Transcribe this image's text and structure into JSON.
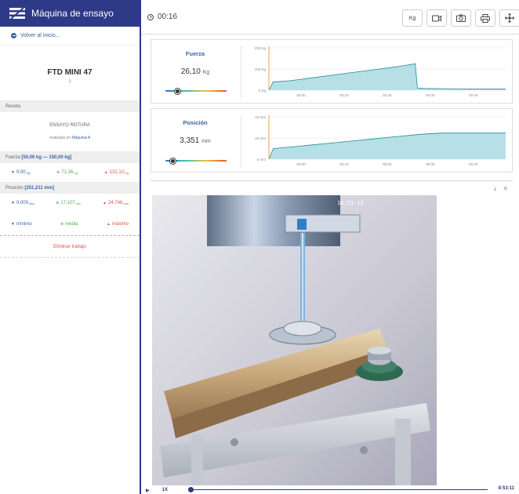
{
  "app": {
    "title": "Máquina de ensayo",
    "back_label": "Volver al inicio..."
  },
  "machine": {
    "name": "FTD MINI 47",
    "number": "1"
  },
  "recipe": {
    "header": "Receta",
    "name": "ENSAYO ROTURA",
    "performed_in_prefix": "realizado en",
    "performed_in_machine": "Máquina A"
  },
  "force_stats": {
    "header_prefix": "Fuerza",
    "range": "[50,00 kg — 150,00 kg]",
    "min": "0,00",
    "avg": "71,36",
    "max": "132,10",
    "unit": "Kg"
  },
  "position_stats": {
    "header_prefix": "Posición",
    "range": "[251,211 mm]",
    "min": "0,009",
    "avg": "17,107",
    "max": "24,748",
    "unit": "mm"
  },
  "legend": {
    "min": "mínimo",
    "avg": "media",
    "max": "máximo"
  },
  "delete_label": "Eliminar trabajo",
  "topbar": {
    "time": "00:16",
    "unit_button": "Kg"
  },
  "colors": {
    "brand": "#2e3a87",
    "accent": "#3a5fa8",
    "chart_line": "#1f8a9c",
    "chart_fill": "#a9dbe0",
    "marker": "#f0a030"
  },
  "chart_data": [
    {
      "type": "area",
      "title": "Fuerza",
      "current_value": "26,10",
      "current_unit": "Kg",
      "gauge_level": 0.2,
      "y_ticks": [
        "200 Kg",
        "100 Kg",
        "0 Kg"
      ],
      "ylim": [
        0,
        200
      ],
      "x_ticks": [
        "00:00",
        "00:10",
        "00:20",
        "00:30",
        "00:40",
        "00:50"
      ],
      "x": [
        0,
        1,
        2,
        5,
        10,
        15,
        20,
        25,
        30,
        34,
        34.5,
        36,
        40,
        45,
        50,
        55
      ],
      "values": [
        0,
        40,
        40,
        45,
        58,
        72,
        85,
        98,
        112,
        125,
        10,
        8,
        7,
        6,
        6,
        6
      ]
    },
    {
      "type": "area",
      "title": "Posición",
      "current_value": "3,351",
      "current_unit": "mm",
      "gauge_level": 0.12,
      "y_ticks": [
        "40 mm",
        "20 mm",
        "0 mm"
      ],
      "ylim": [
        0,
        40
      ],
      "x_ticks": [
        "00:00",
        "00:10",
        "00:20",
        "00:30",
        "00:40",
        "00:50"
      ],
      "x": [
        0,
        1,
        5,
        10,
        15,
        20,
        25,
        30,
        35,
        40,
        45,
        50,
        55
      ],
      "values": [
        0,
        10,
        11.5,
        13.5,
        15.5,
        17.5,
        19.5,
        21.5,
        23.5,
        24.7,
        24.7,
        24.7,
        24.7
      ]
    }
  ],
  "video": {
    "timestamp": "10:53:13",
    "speed": "1X",
    "time": "8:53:11"
  }
}
